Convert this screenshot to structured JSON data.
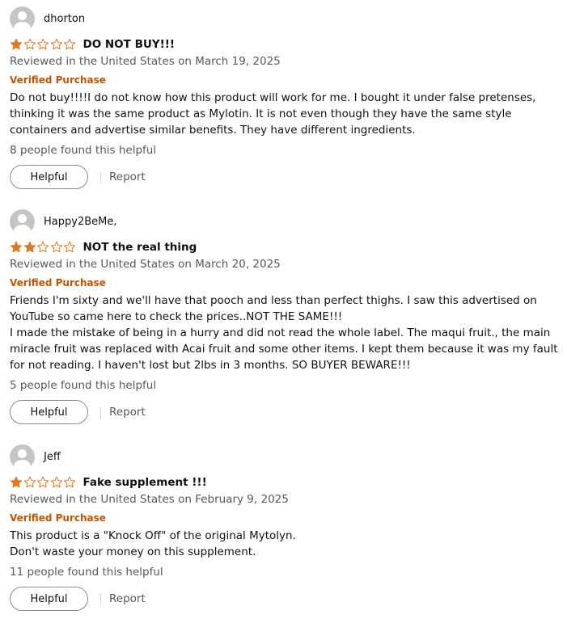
{
  "colors": {
    "star": "#DE7921",
    "verified": "#C45500",
    "meta": "#565959",
    "text": "#0F1111"
  },
  "reviews": [
    {
      "username": "dhorton",
      "rating": 1,
      "title": "DO NOT BUY!!!",
      "meta": "Reviewed in the United States on March 19, 2025",
      "verified": "Verified Purchase",
      "text": "Do not buy!!!!I do not know how this product will work for me. I bought it under false pretenses, thinking it was the same product as Mylotin. It is not even though they have the same style containers and advertise similar benefits. They have different ingredients.",
      "helpful_count": "8 people found this helpful",
      "helpful_label": "Helpful",
      "report_label": "Report"
    },
    {
      "username": "Happy2BeMe,",
      "rating": 2,
      "title": "NOT the real thing",
      "meta": "Reviewed in the United States on March 20, 2025",
      "verified": "Verified Purchase",
      "text": "Friends I'm sixty and we'll have that pooch and less than perfect thighs. I saw this advertised on YouTube so came here to check the prices..NOT THE SAME!!!\nI made the mistake of being in a hurry and did not read the whole label. The maqui fruit., the main miracle fruit was replaced with Acai fruit and some other items. I kept them because it was my fault for not reading. I haven't lost but 2lbs in 3 months. SO BUYER BEWARE!!!",
      "helpful_count": "5 people found this helpful",
      "helpful_label": "Helpful",
      "report_label": "Report"
    },
    {
      "username": "Jeff",
      "rating": 1,
      "title": "Fake supplement !!!",
      "meta": "Reviewed in the United States on February 9, 2025",
      "verified": "Verified Purchase",
      "text": "This product is a \"Knock Off\" of the original Mytolyn.\nDon't waste your money on this supplement.",
      "helpful_count": "11 people found this helpful",
      "helpful_label": "Helpful",
      "report_label": "Report"
    }
  ]
}
